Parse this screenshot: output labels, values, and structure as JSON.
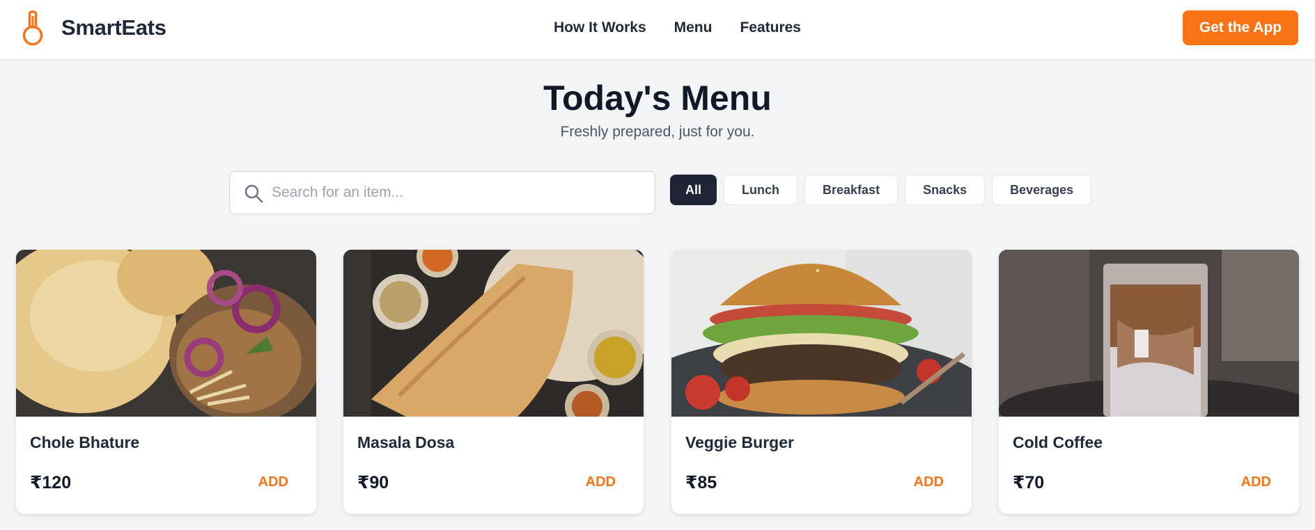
{
  "brand": {
    "name": "SmartEats",
    "accent": "#f97316"
  },
  "nav": {
    "items": [
      "How It Works",
      "Menu",
      "Features"
    ]
  },
  "header": {
    "cta_label": "Get the App"
  },
  "hero": {
    "title": "Today's Menu",
    "subtitle": "Freshly prepared, just for you."
  },
  "search": {
    "placeholder": "Search for an item...",
    "value": ""
  },
  "filters": [
    "All",
    "Lunch",
    "Breakfast",
    "Snacks",
    "Beverages"
  ],
  "filter_selected": "All",
  "menu": [
    {
      "name": "Chole Bhature",
      "price": "₹120",
      "action": "ADD"
    },
    {
      "name": "Masala Dosa",
      "price": "₹90",
      "action": "ADD"
    },
    {
      "name": "Veggie Burger",
      "price": "₹85",
      "action": "ADD"
    },
    {
      "name": "Cold Coffee",
      "price": "₹70",
      "action": "ADD"
    }
  ],
  "icons": {
    "logo": "thermometer-logo-icon",
    "search": "search-icon"
  }
}
